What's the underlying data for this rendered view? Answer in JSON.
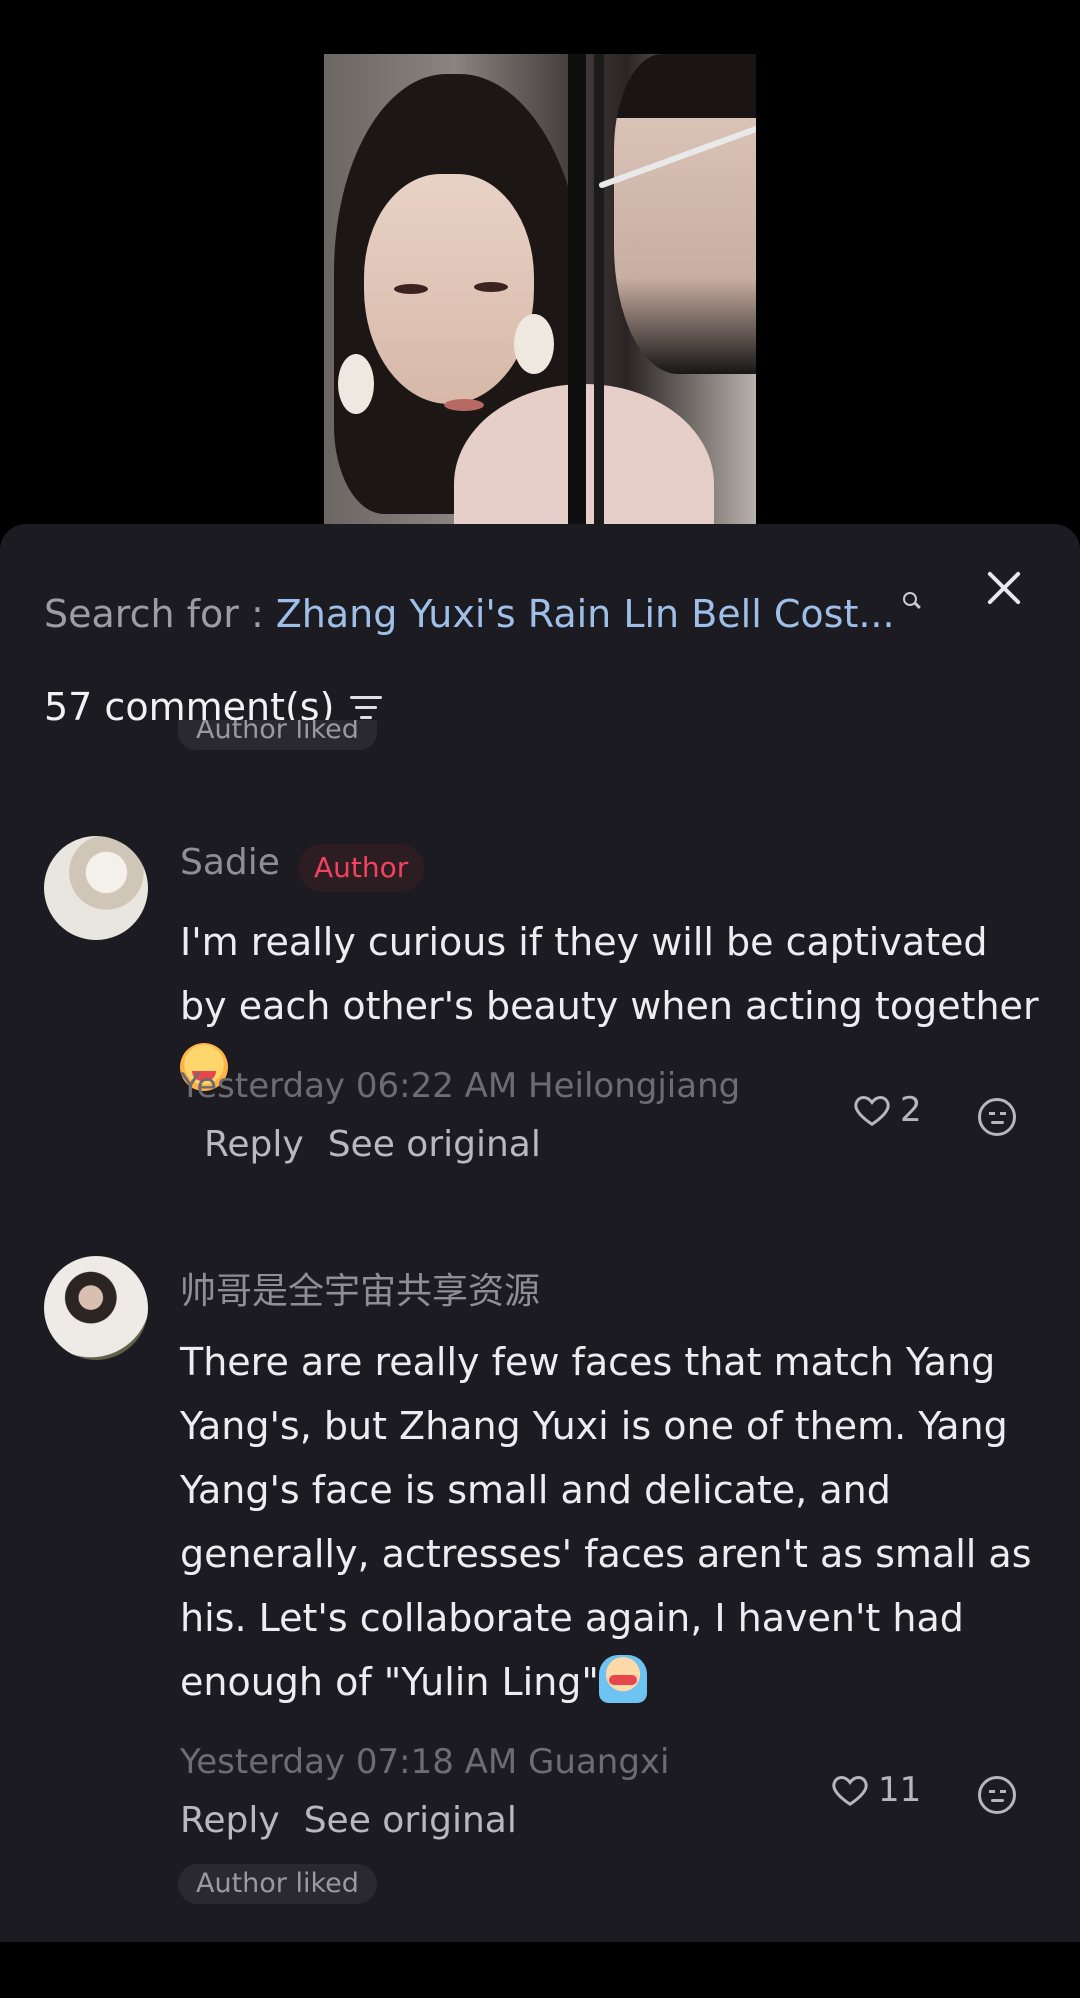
{
  "search": {
    "prefix": "Search for :",
    "term": "Zhang Yuxi's Rain Lin Bell Cost..."
  },
  "comments_header": {
    "count_label": "57 comment(s)"
  },
  "tags": {
    "author_liked": "Author liked"
  },
  "comments": [
    {
      "username": "Sadie",
      "badge": "Author",
      "text": "I'm really curious if they will be captivated by each other's beauty when acting together",
      "emoji": "crying-face-emoji",
      "meta": "Yesterday 06:22 AM Heilongjiang",
      "reply": "Reply",
      "see_original": "See original",
      "likes": "2"
    },
    {
      "username": "帅哥是全宇宙共享资源",
      "text": "There are really few faces that match Yang Yang's, but Zhang Yuxi is one of them. Yang Yang's face is small and delicate, and generally, actresses' faces aren't as small as his. Let's collaborate again, I haven't had enough of \"Yulin Ling\"",
      "emoji": "crying-flood-emoji",
      "meta": "Yesterday 07:18 AM Guangxi",
      "reply": "Reply",
      "see_original": "See original",
      "likes": "11",
      "tag": "Author liked"
    }
  ],
  "icons": [
    "search-icon",
    "close-icon",
    "sort-icon",
    "heart-icon",
    "dislike-icon"
  ],
  "colors": {
    "sheet_bg": "#1c1b21",
    "link_blue": "#9dbfe8",
    "author_red": "#f2425d"
  }
}
